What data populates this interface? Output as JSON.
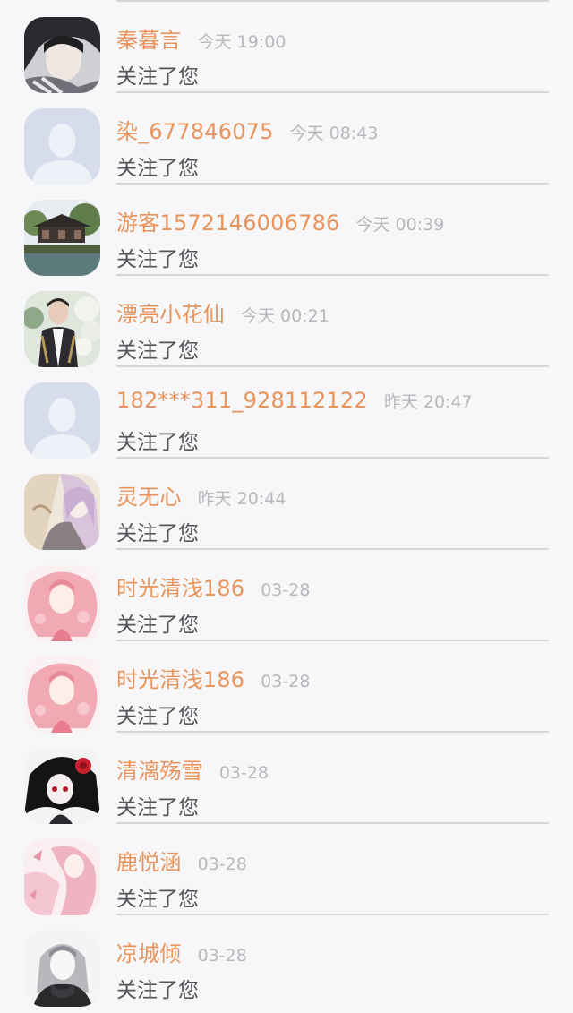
{
  "notifications": [
    {
      "name": "秦暮言",
      "time": "今天 19:00",
      "message": "关注了您",
      "avatar": "photo-dark-hair-girl"
    },
    {
      "name": "染_677846075",
      "time": "今天 08:43",
      "message": "关注了您",
      "avatar": "default-user-icon"
    },
    {
      "name": "游客1572146006786",
      "time": "今天 00:39",
      "message": "关注了您",
      "avatar": "landscape-pavilion"
    },
    {
      "name": "漂亮小花仙",
      "time": "今天 00:21",
      "message": "关注了您",
      "avatar": "photo-man-with-flowers"
    },
    {
      "name": "182***311_928112122",
      "time": "昨天 20:47",
      "message": "关注了您",
      "avatar": "default-user-icon"
    },
    {
      "name": "灵无心",
      "time": "昨天 20:44",
      "message": "关注了您",
      "avatar": "anime-pale-couple"
    },
    {
      "name": "时光清浅186",
      "time": "03-28",
      "message": "关注了您",
      "avatar": "anime-pink-girl"
    },
    {
      "name": "时光清浅186",
      "time": "03-28",
      "message": "关注了您",
      "avatar": "anime-pink-girl"
    },
    {
      "name": "清漓殇雪",
      "time": "03-28",
      "message": "关注了您",
      "avatar": "anime-black-hair-red-rose"
    },
    {
      "name": "鹿悦涵",
      "time": "03-28",
      "message": "关注了您",
      "avatar": "anime-pink-hair"
    },
    {
      "name": "凉城倾",
      "time": "03-28",
      "message": "关注了您",
      "avatar": "sketch-girl-dark-coat"
    }
  ],
  "colors": {
    "name": "#e8945c",
    "time": "#b9b8bc",
    "message": "#555458",
    "divider": "#d6d5d8",
    "background": "#f7f6f8",
    "default_avatar": "#d6dceb"
  }
}
